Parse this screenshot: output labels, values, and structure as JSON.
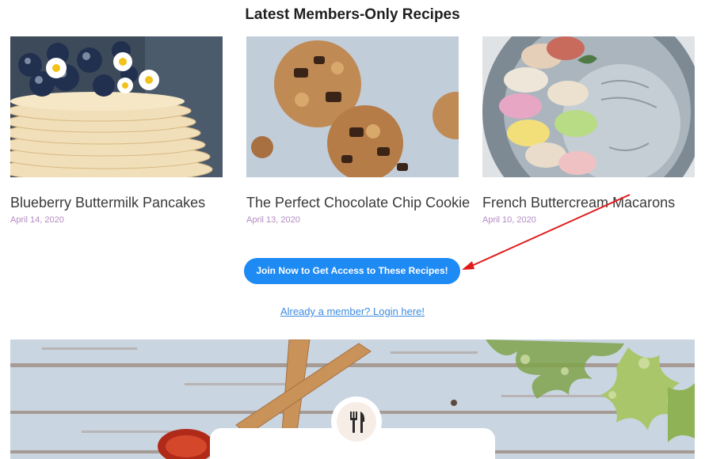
{
  "section": {
    "title": "Latest Members-Only Recipes"
  },
  "recipes": [
    {
      "title": "Blueberry Buttermilk Pancakes",
      "date": "April 14, 2020"
    },
    {
      "title": "The Perfect Chocolate Chip Cookie",
      "date": "April 13, 2020"
    },
    {
      "title": "French Buttercream Macarons",
      "date": "April 10, 2020"
    }
  ],
  "cta": {
    "label": "Join Now to Get Access to These Recipes!"
  },
  "login": {
    "label": "Already a member? Login here!"
  },
  "colors": {
    "accent": "#1e8af3",
    "date": "#b48bc4",
    "link": "#3d8be0",
    "annotation_arrow": "#e01b1b"
  },
  "icons": {
    "hero_badge": "fork-knife-icon"
  }
}
